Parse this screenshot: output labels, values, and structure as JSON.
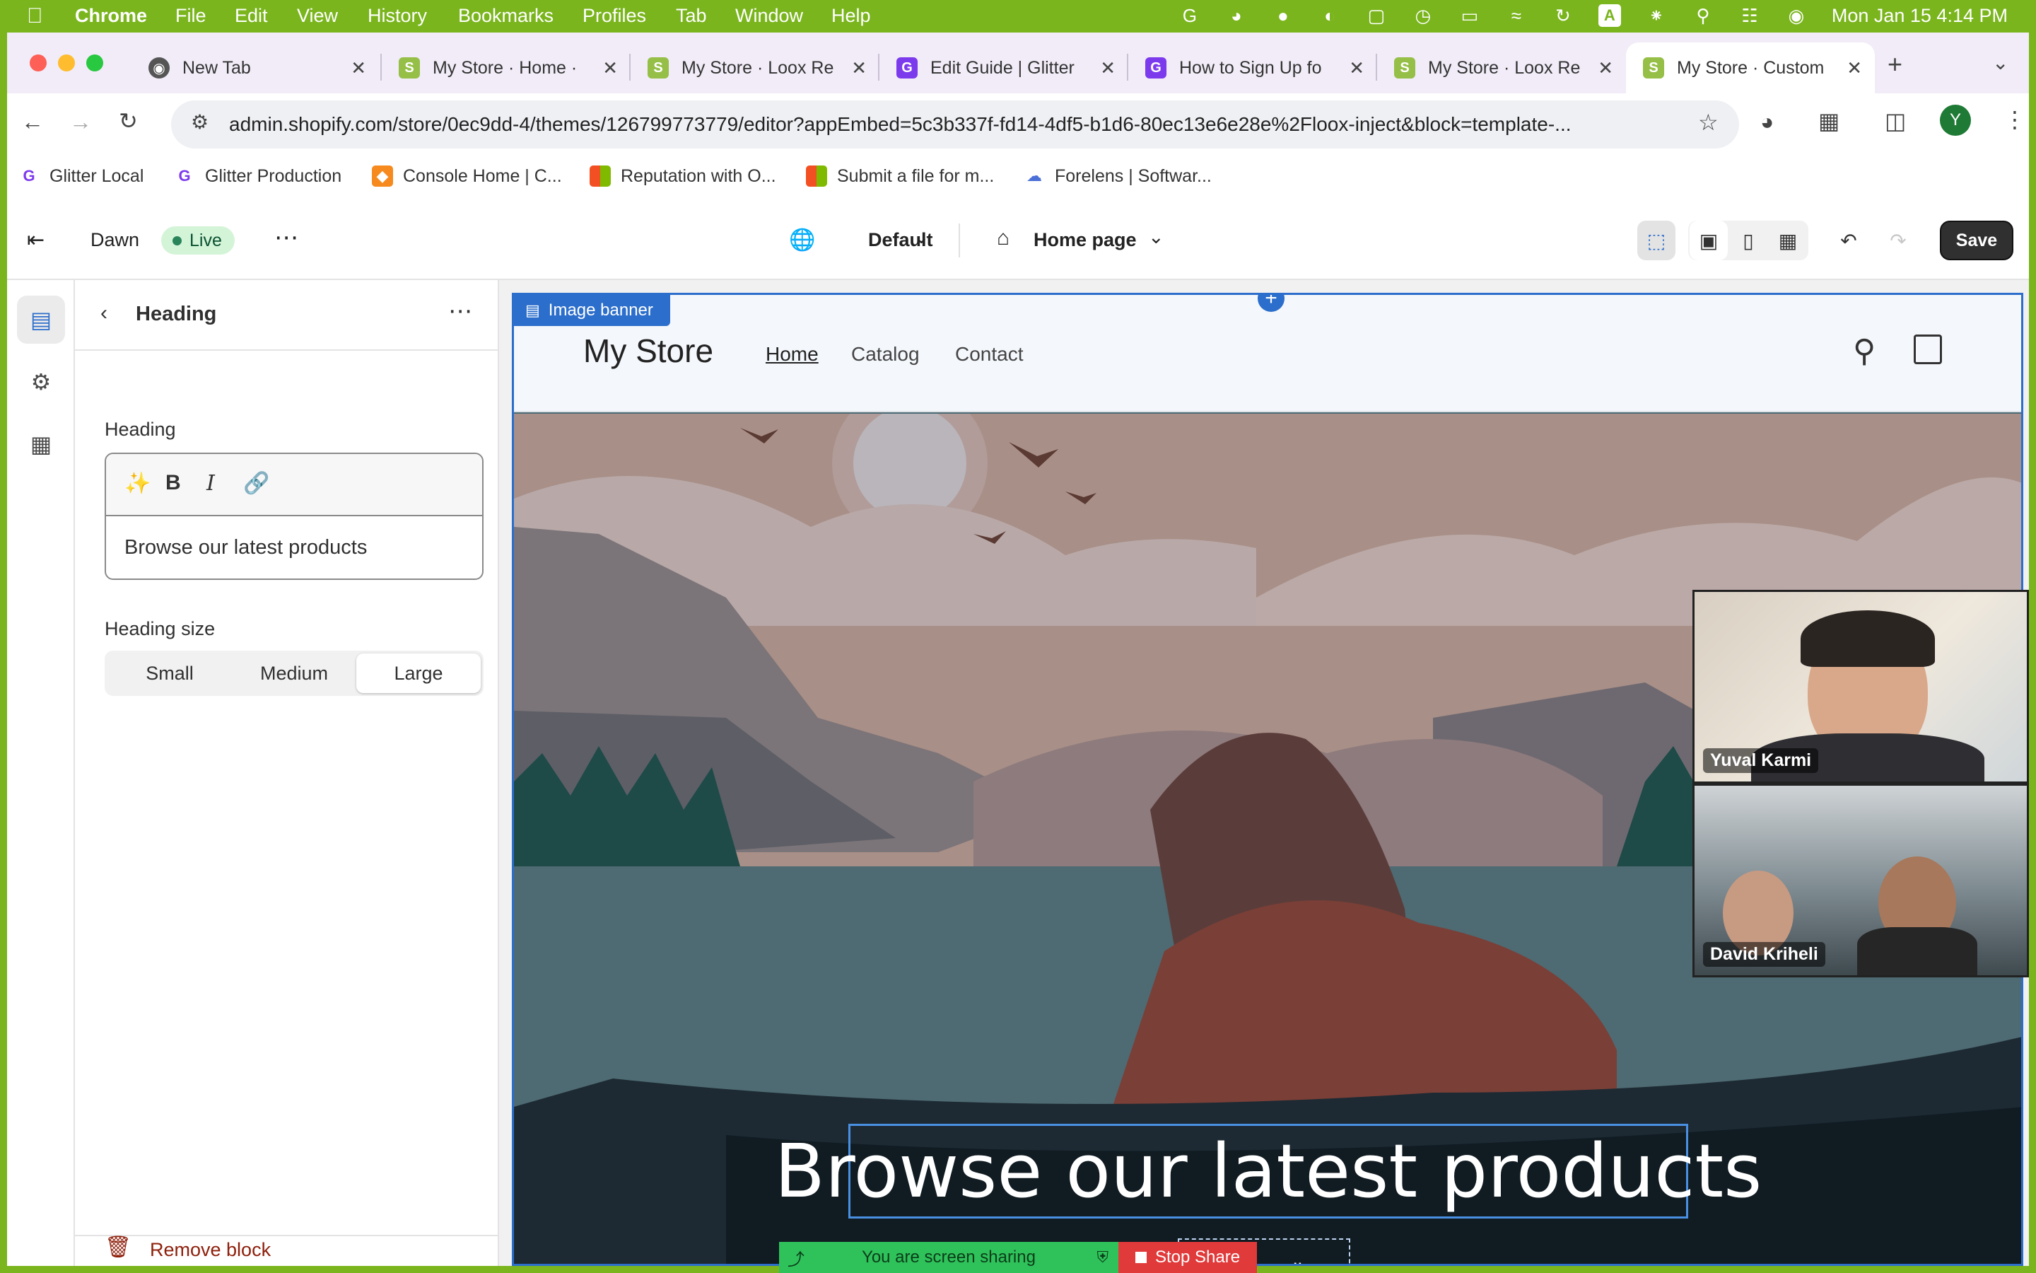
{
  "menubar": {
    "app": "Chrome",
    "items": [
      "File",
      "Edit",
      "View",
      "History",
      "Bookmarks",
      "Profiles",
      "Tab",
      "Window",
      "Help"
    ],
    "clock": "Mon Jan 15  4:14 PM",
    "input_badge": "A"
  },
  "tabs": [
    {
      "title": "New Tab",
      "icon": "chrome-icon"
    },
    {
      "title": "My Store · Home ·",
      "icon": "shopify-icon"
    },
    {
      "title": "My Store · Loox Re",
      "icon": "shopify-icon"
    },
    {
      "title": "Edit Guide | Glitter",
      "icon": "glitter-icon"
    },
    {
      "title": "How to Sign Up fo",
      "icon": "glitter-icon"
    },
    {
      "title": "My Store · Loox Re",
      "icon": "shopify-icon"
    },
    {
      "title": "My Store · Custom",
      "icon": "shopify-icon",
      "active": true
    }
  ],
  "address_bar": {
    "url": "admin.shopify.com/store/0ec9dd-4/themes/126799773779/editor?appEmbed=5c3b337f-fd14-4df5-b1d6-80ec13e6e28e%2Floox-inject&block=template-..."
  },
  "profile_initial": "Y",
  "bookmarks": [
    {
      "label": "Glitter Local",
      "icon": "glitter-icon"
    },
    {
      "label": "Glitter Production",
      "icon": "glitter-icon"
    },
    {
      "label": "Console Home | C...",
      "icon": "aws-icon"
    },
    {
      "label": "Reputation with O...",
      "icon": "microsoft-icon"
    },
    {
      "label": "Submit a file for m...",
      "icon": "microsoft-icon"
    },
    {
      "label": "Forelens | Softwar...",
      "icon": "cloud-icon"
    }
  ],
  "editor": {
    "theme_name": "Dawn",
    "status": "Live",
    "locale": "Default",
    "page": "Home page",
    "save_label": "Save"
  },
  "sidebar": {
    "title": "Heading",
    "field_label": "Heading",
    "field_value": "Browse our latest products",
    "size_label": "Heading size",
    "size_options": [
      "Small",
      "Medium",
      "Large"
    ],
    "size_selected": "Large",
    "remove_label": "Remove block"
  },
  "preview": {
    "section_tag": "Image banner",
    "store_name": "My Store",
    "nav": [
      "Home",
      "Catalog",
      "Contact"
    ],
    "hero_heading": "Browse our latest products",
    "button_label": "Shop all"
  },
  "participants": [
    {
      "name": "Yuval Karmi"
    },
    {
      "name": "David Kriheli"
    }
  ],
  "screen_share": {
    "status": "You are screen sharing",
    "stop_label": "Stop Share"
  },
  "colors": {
    "accent_blue": "#2c6ecb",
    "live_green": "#29845a",
    "desktop_green": "#7ab51d",
    "stop_red": "#e03a3a"
  }
}
